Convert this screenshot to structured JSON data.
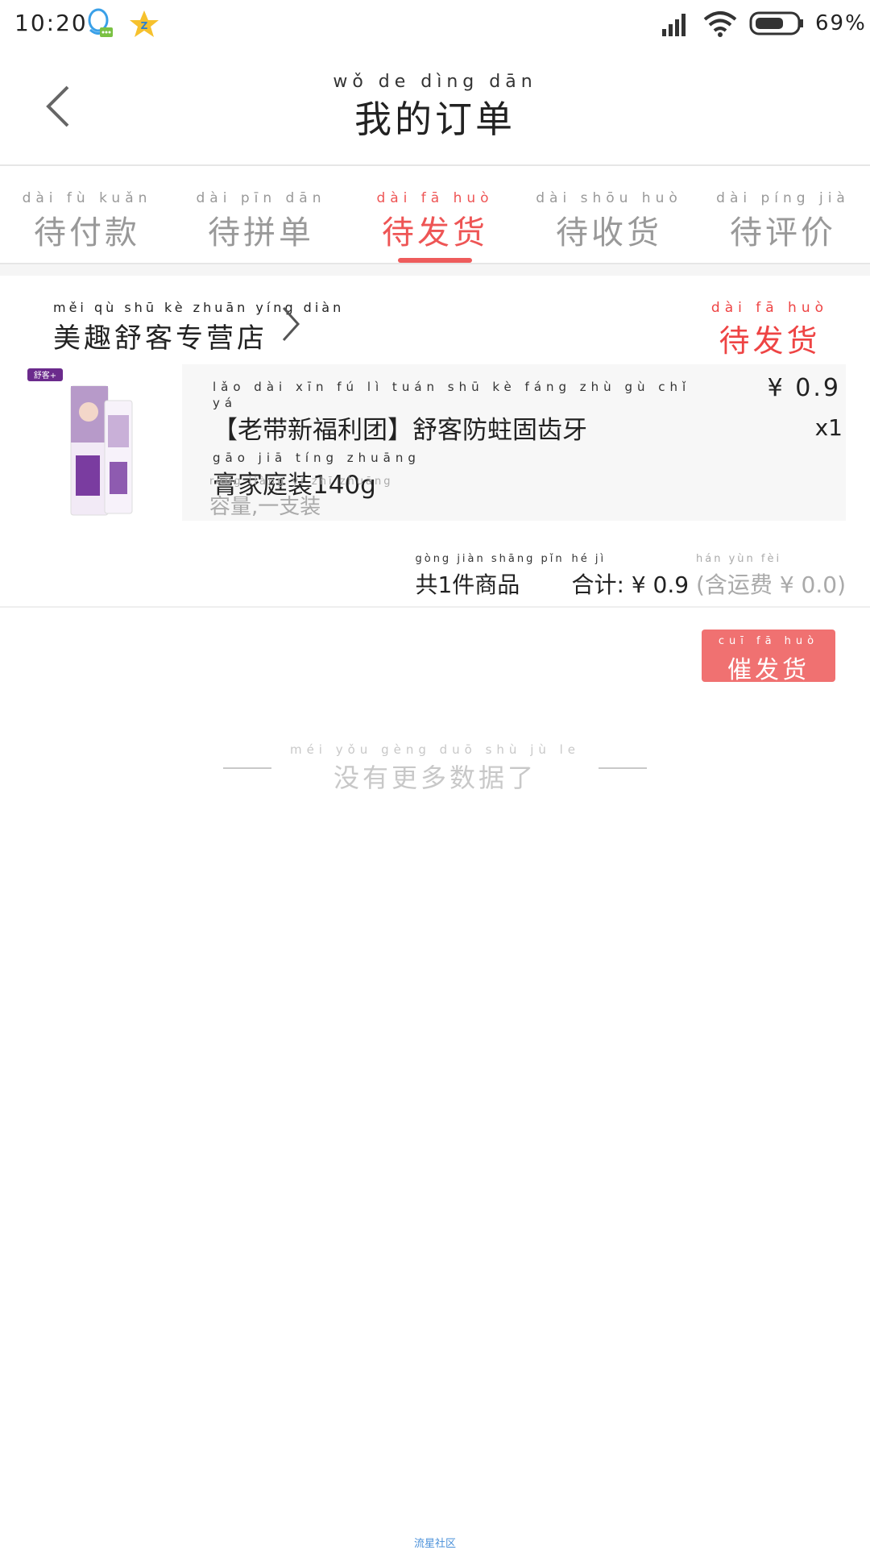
{
  "status_bar": {
    "time": "10:20",
    "battery_percent": "69%",
    "battery_level": 0.69,
    "icons": [
      "qq-icon",
      "qzone-star-icon",
      "signal-icon",
      "wifi-icon",
      "battery-icon"
    ]
  },
  "header": {
    "title_pinyin": "wǒ de dìng dān",
    "title": "我的订单"
  },
  "tabs": [
    {
      "pinyin": "dài fù kuǎn",
      "label": "待付款",
      "active": false
    },
    {
      "pinyin": "dài pīn dān",
      "label": "待拼单",
      "active": false
    },
    {
      "pinyin": "dài fā huò",
      "label": "待发货",
      "active": true
    },
    {
      "pinyin": "dài shōu huò",
      "label": "待收货",
      "active": false
    },
    {
      "pinyin": "dài píng jià",
      "label": "待评价",
      "active": false
    }
  ],
  "order": {
    "store_pinyin": "měi qù shū kè zhuān yíng diàn",
    "store_name": "美趣舒客专营店",
    "status_pinyin": "dài fā huò",
    "status": "待发货",
    "product": {
      "title_pinyin_1": "lǎo dài xīn fú lì tuán shū kè fáng zhù gù chǐ yá",
      "title_line_1": "【老带新福利团】舒客防蛀固齿牙",
      "title_pinyin_2": "gāo jiā tíng zhuāng",
      "title_line_2": "膏家庭装140g",
      "spec_pinyin": "róng liàng yī zhī zhuāng",
      "spec": "容量,一支装",
      "price": "¥ 0.9",
      "quantity": "x1"
    },
    "summary": {
      "pinyin_count": "gòng jiàn shāng pǐn",
      "count_text": "共1件商品",
      "pinyin_total": "hé jì",
      "total_label": "合计:",
      "total_value": "¥ 0.9",
      "pinyin_shipping": "hán yùn fèi",
      "shipping_text": "(含运费 ¥ 0.0)"
    },
    "action_pinyin": "cuī fā huò",
    "action_label": "催发货"
  },
  "empty_hint": {
    "pinyin": "méi yǒu gèng duō shù jù le",
    "text": "没有更多数据了"
  },
  "footer": {
    "text": "流星社区"
  },
  "colors": {
    "accent": "#ee5555",
    "button": "#f07171",
    "muted": "#999999"
  }
}
